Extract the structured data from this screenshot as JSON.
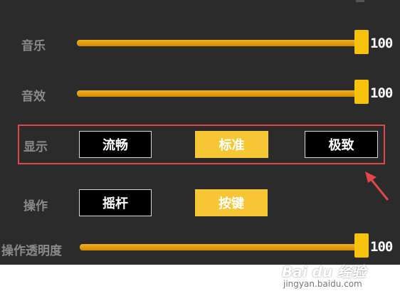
{
  "settings": {
    "music": {
      "label": "音乐",
      "value": "100",
      "level": 1.0
    },
    "sfx": {
      "label": "音效",
      "value": "100",
      "level": 1.0
    },
    "display": {
      "label": "显示",
      "options": [
        "流畅",
        "标准",
        "极致"
      ],
      "selected": "标准"
    },
    "control": {
      "label": "操作",
      "options": [
        "摇杆",
        "按键"
      ],
      "selected": "按键"
    },
    "opacity": {
      "label": "操作透明度",
      "value": "100",
      "level": 1.0
    }
  },
  "watermark": {
    "logo": "Bai du 经验",
    "url": "jingyan.baidu.com"
  },
  "colors": {
    "panel_bg": "#2b2b2b",
    "accent": "#f6c634",
    "highlight": "#e04848"
  }
}
